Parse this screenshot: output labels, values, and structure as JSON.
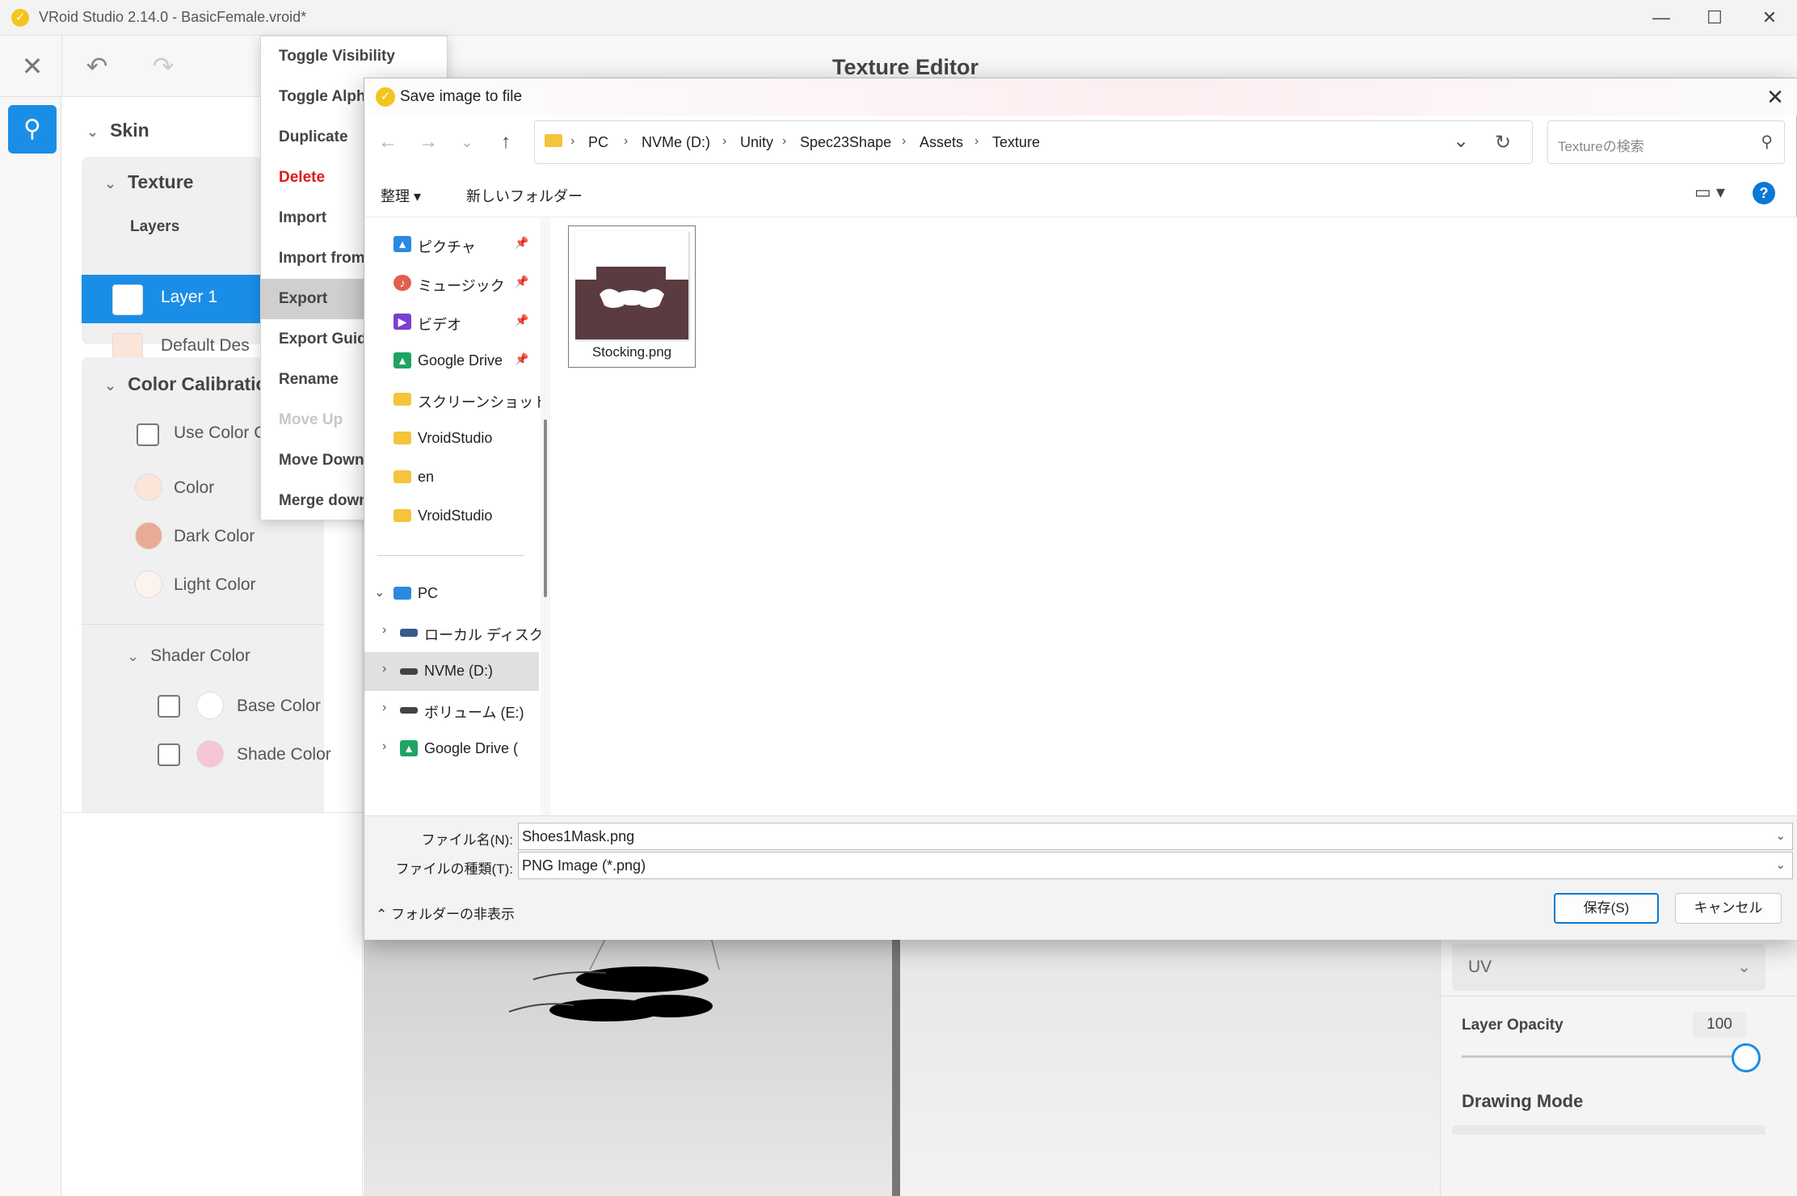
{
  "window": {
    "title": "VRoid Studio 2.14.0 - BasicFemale.vroid*",
    "app_icon": "✓",
    "minimize": "—",
    "maximize": "☐",
    "close": "✕"
  },
  "toolbar": {
    "close_icon": "✕",
    "undo_icon": "↶",
    "redo_icon": "↷",
    "editor_title": "Texture Editor"
  },
  "rail": {
    "icon": "⚲"
  },
  "panel": {
    "skin": "Skin",
    "texture": "Texture",
    "layers": "Layers",
    "layer1": "Layer 1",
    "default_layer": "Default Des",
    "color_calibration": "Color Calibratio",
    "use_color": "Use Color C",
    "color": "Color",
    "dark_color": "Dark Color",
    "light_color": "Light Color",
    "shader_color": "Shader Color",
    "base_color": "Base Color",
    "shade_color": "Shade Color"
  },
  "colors": {
    "accent": "#1a8ee6",
    "skin_color": "#fbe4d8",
    "dark_color": "#e9ab94",
    "light_color": "#fdf3ee",
    "base_color": "#ffffff",
    "shade_color": "#f5c6d4",
    "delete_red": "#e01818"
  },
  "context_menu": {
    "items": [
      {
        "label": "Toggle Visibility"
      },
      {
        "label": "Toggle Alpha"
      },
      {
        "label": "Duplicate"
      },
      {
        "label": "Delete"
      },
      {
        "label": "Import"
      },
      {
        "label": "Import from"
      },
      {
        "label": "Export"
      },
      {
        "label": "Export Guide"
      },
      {
        "label": "Rename"
      },
      {
        "label": "Move Up"
      },
      {
        "label": "Move Down"
      },
      {
        "label": "Merge down"
      }
    ]
  },
  "dialog": {
    "title": "Save image to file",
    "close": "✕",
    "back": "←",
    "forward": "→",
    "recent": "⌄",
    "up": "↑",
    "breadcrumbs": [
      "PC",
      "NVMe (D:)",
      "Unity",
      "Spec23Shape",
      "Assets",
      "Texture"
    ],
    "crumb_sep": "›",
    "refresh": "↻",
    "address_dropdown": "⌄",
    "search_placeholder": "Textureの検索",
    "search_icon": "⚲",
    "organize": "整理 ▾",
    "new_folder": "新しいフォルダー",
    "view": "▭ ▾",
    "help": "?",
    "nav": [
      {
        "label": "ピクチャ",
        "pinned": "📌"
      },
      {
        "label": "ミュージック",
        "pinned": "📌"
      },
      {
        "label": "ビデオ",
        "pinned": "📌"
      },
      {
        "label": "Google Drive",
        "pinned": "📌"
      },
      {
        "label": "スクリーンショット"
      },
      {
        "label": "VroidStudio"
      },
      {
        "label": "en"
      },
      {
        "label": "VroidStudio"
      },
      {
        "label": "PC"
      },
      {
        "label": "ローカル ディスク"
      },
      {
        "label": "NVMe (D:)"
      },
      {
        "label": "ボリューム (E:)"
      },
      {
        "label": "Google Drive ("
      }
    ],
    "files": [
      {
        "name": "Stocking.png"
      }
    ],
    "filename_label": "ファイル名(N):",
    "filename_value": "Shoes1Mask.png",
    "filetype_label": "ファイルの種類(T):",
    "filetype_value": "PNG Image (*.png)",
    "hide_folders": "フォルダーの非表示",
    "save": "保存(S)",
    "cancel": "キャンセル"
  },
  "right_panel": {
    "uv": "UV",
    "layer_opacity": "Layer Opacity",
    "opacity_value": "100",
    "drawing_mode": "Drawing Mode"
  }
}
